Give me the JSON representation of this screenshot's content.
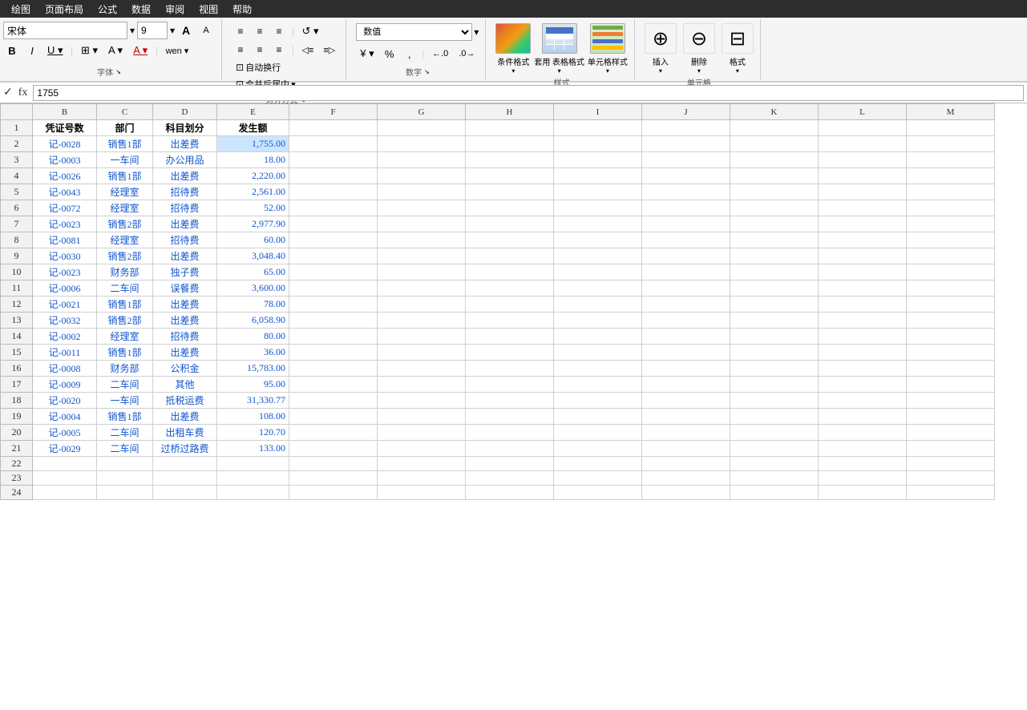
{
  "menuBar": {
    "items": [
      "绘图",
      "页面布局",
      "公式",
      "数据",
      "审阅",
      "视图",
      "帮助"
    ]
  },
  "ribbon": {
    "fontName": "宋体",
    "fontSize": "9",
    "numberFormat": "数值",
    "wrapText": "自动换行",
    "mergeCenter": "合并后居中",
    "sections": {
      "font": "字体",
      "alignment": "对齐方式",
      "number": "数字",
      "style": "样式",
      "cells": "单元格"
    },
    "buttons": {
      "conditionalFormat": "条件格式",
      "tableFormat": "套用\n表格格式",
      "cellStyle": "单元格样式",
      "insert": "插入",
      "delete": "删除",
      "format": "格式"
    }
  },
  "formulaBar": {
    "cellRef": "E2",
    "formula": "1755",
    "fxLabel": "fx"
  },
  "columnHeaders": [
    "B",
    "C",
    "D",
    "E",
    "F",
    "G",
    "H",
    "I",
    "J",
    "K",
    "L",
    "M"
  ],
  "dataHeaders": [
    "凭证号数",
    "部门",
    "科目划分",
    "发生额"
  ],
  "rows": [
    {
      "id": 1,
      "b": "记-0028",
      "c": "销售1部",
      "d": "出差费",
      "e": "1,755.00"
    },
    {
      "id": 2,
      "b": "记-0003",
      "c": "一车间",
      "d": "办公用品",
      "e": "18.00"
    },
    {
      "id": 3,
      "b": "记-0026",
      "c": "销售1部",
      "d": "出差费",
      "e": "2,220.00"
    },
    {
      "id": 4,
      "b": "记-0043",
      "c": "经理室",
      "d": "招待费",
      "e": "2,561.00"
    },
    {
      "id": 5,
      "b": "记-0072",
      "c": "经理室",
      "d": "招待费",
      "e": "52.00"
    },
    {
      "id": 6,
      "b": "记-0023",
      "c": "销售2部",
      "d": "出差费",
      "e": "2,977.90"
    },
    {
      "id": 7,
      "b": "记-0081",
      "c": "经理室",
      "d": "招待费",
      "e": "60.00"
    },
    {
      "id": 8,
      "b": "记-0030",
      "c": "销售2部",
      "d": "出差费",
      "e": "3,048.40"
    },
    {
      "id": 9,
      "b": "记-0023",
      "c": "财务部",
      "d": "独子费",
      "e": "65.00"
    },
    {
      "id": 10,
      "b": "记-0006",
      "c": "二车间",
      "d": "误餐费",
      "e": "3,600.00"
    },
    {
      "id": 11,
      "b": "记-0021",
      "c": "销售1部",
      "d": "出差费",
      "e": "78.00"
    },
    {
      "id": 12,
      "b": "记-0032",
      "c": "销售2部",
      "d": "出差费",
      "e": "6,058.90"
    },
    {
      "id": 13,
      "b": "记-0002",
      "c": "经理室",
      "d": "招待费",
      "e": "80.00"
    },
    {
      "id": 14,
      "b": "记-0011",
      "c": "销售1部",
      "d": "出差费",
      "e": "36.00"
    },
    {
      "id": 15,
      "b": "记-0008",
      "c": "财务部",
      "d": "公积金",
      "e": "15,783.00"
    },
    {
      "id": 16,
      "b": "记-0009",
      "c": "二车间",
      "d": "其他",
      "e": "95.00"
    },
    {
      "id": 17,
      "b": "记-0020",
      "c": "一车间",
      "d": "抵税运费",
      "e": "31,330.77"
    },
    {
      "id": 18,
      "b": "记-0004",
      "c": "销售1部",
      "d": "出差费",
      "e": "108.00"
    },
    {
      "id": 19,
      "b": "记-0005",
      "c": "二车间",
      "d": "出租车费",
      "e": "120.70"
    },
    {
      "id": 20,
      "b": "记-0029",
      "c": "二车间",
      "d": "过桥过路费",
      "e": "133.00"
    }
  ]
}
